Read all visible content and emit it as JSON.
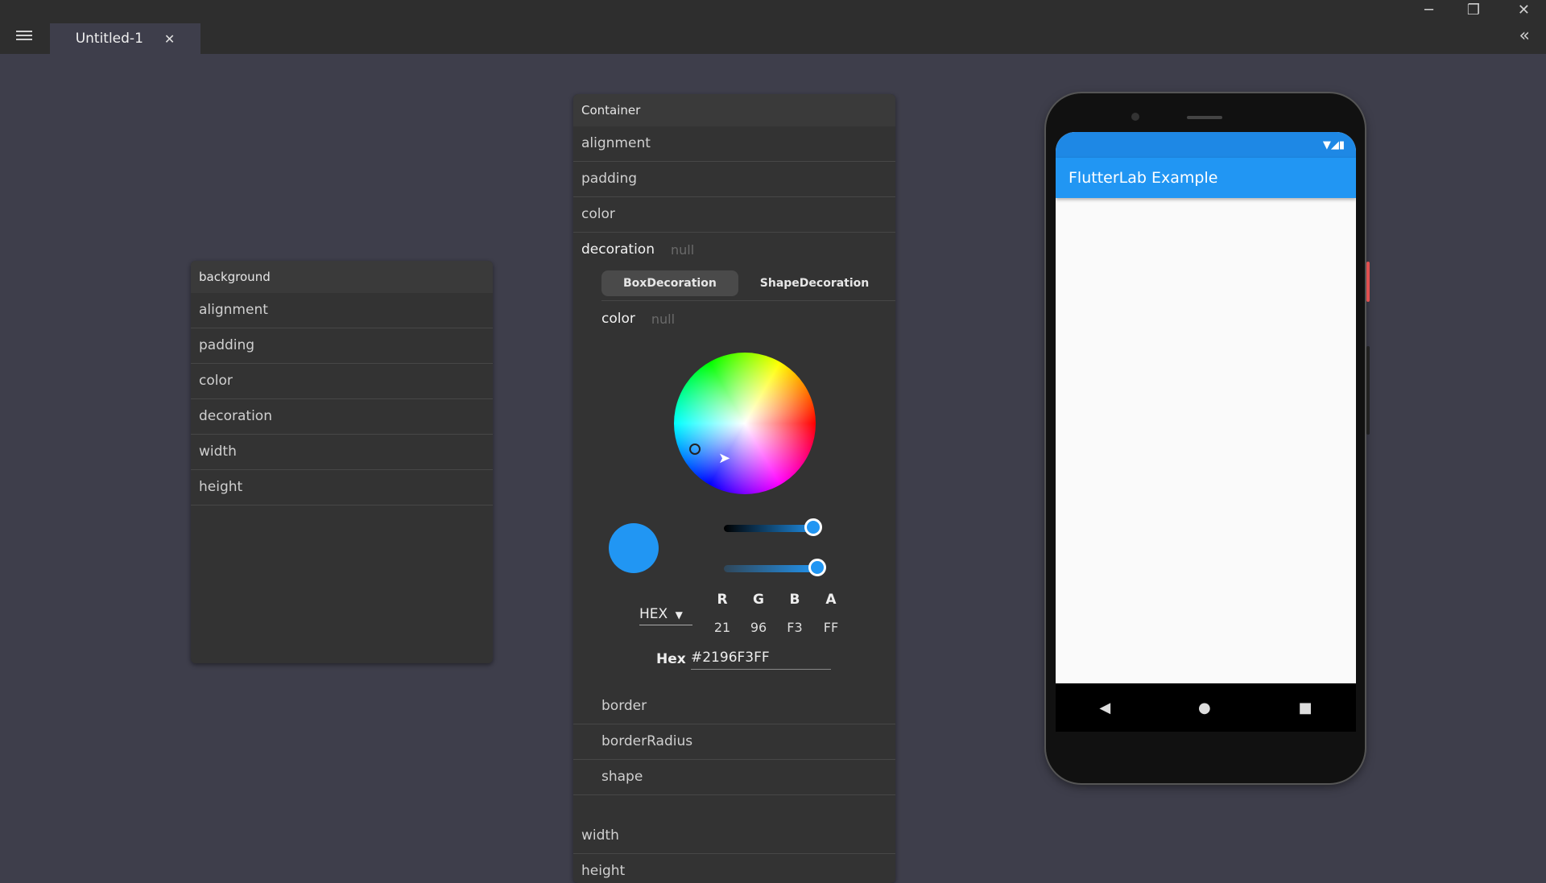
{
  "window": {
    "tab_title": "Untitled-1",
    "tab_close": "✕",
    "minimize": "─",
    "restore": "❐",
    "close": "✕",
    "collapse": "«"
  },
  "background_panel": {
    "title": "background",
    "props": [
      "alignment",
      "padding",
      "color",
      "decoration",
      "width",
      "height"
    ]
  },
  "container_panel": {
    "title": "Container",
    "props_top": [
      "alignment",
      "padding",
      "color"
    ],
    "decoration_label": "decoration",
    "decoration_value": "null",
    "tabs": [
      "BoxDecoration",
      "ShapeDecoration"
    ],
    "color_label": "color",
    "color_value": "null",
    "picker": {
      "format": "HEX",
      "channels": [
        {
          "label": "R",
          "value": "21"
        },
        {
          "label": "G",
          "value": "96"
        },
        {
          "label": "B",
          "value": "F3"
        },
        {
          "label": "A",
          "value": "FF"
        }
      ],
      "hex_label": "Hex",
      "hex_value": "#2196F3FF",
      "selected_color": "#2196F3",
      "value_level": 1.0,
      "alpha_level": 1.0
    },
    "sub_props": [
      "border",
      "borderRadius",
      "shape"
    ],
    "props_bottom": [
      "width",
      "height"
    ]
  },
  "phone": {
    "app_title": "FlutterLab Example",
    "status_icons": "▼◢▮",
    "nav_back": "◀",
    "nav_home": "●",
    "nav_recent": "■"
  }
}
